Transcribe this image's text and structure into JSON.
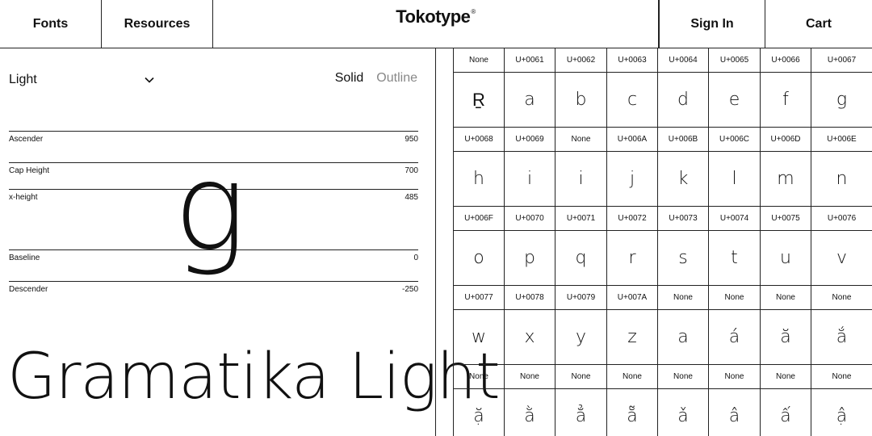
{
  "header": {
    "fonts_label": "Fonts",
    "resources_label": "Resources",
    "logo_text": "Tokotype",
    "logo_mark": "®",
    "signin_label": "Sign In",
    "cart_label": "Cart"
  },
  "weight": {
    "selected": "Light",
    "chevron_icon": "chevron-down-icon"
  },
  "style_toggle": {
    "solid_label": "Solid",
    "outline_label": "Outline"
  },
  "metrics": [
    {
      "label": "Ascender",
      "value": "950"
    },
    {
      "label": "Cap Height",
      "value": "700"
    },
    {
      "label": "x-height",
      "value": "485"
    },
    {
      "label": "Baseline",
      "value": "0"
    },
    {
      "label": "Descender",
      "value": "-250"
    }
  ],
  "preview_glyph": "g",
  "specimen_text": "Gramatika Light",
  "glyph_grid": [
    {
      "codes": [
        "None",
        "U+0061",
        "U+0062",
        "U+0063",
        "U+0064",
        "U+0065",
        "U+0066",
        "U+0067"
      ],
      "glyphs": [
        "R̠",
        "a",
        "b",
        "c",
        "d",
        "e",
        "f",
        "g"
      ]
    },
    {
      "codes": [
        "U+0068",
        "U+0069",
        "None",
        "U+006A",
        "U+006B",
        "U+006C",
        "U+006D",
        "U+006E"
      ],
      "glyphs": [
        "h",
        "i",
        "i",
        "j",
        "k",
        "l",
        "m",
        "n"
      ]
    },
    {
      "codes": [
        "U+006F",
        "U+0070",
        "U+0071",
        "U+0072",
        "U+0073",
        "U+0074",
        "U+0075",
        "U+0076"
      ],
      "glyphs": [
        "o",
        "p",
        "q",
        "r",
        "s",
        "t",
        "u",
        "v"
      ]
    },
    {
      "codes": [
        "U+0077",
        "U+0078",
        "U+0079",
        "U+007A",
        "None",
        "None",
        "None",
        "None"
      ],
      "glyphs": [
        "w",
        "x",
        "y",
        "z",
        "a",
        "á",
        "ă",
        "ắ"
      ]
    },
    {
      "codes": [
        "None",
        "None",
        "None",
        "None",
        "None",
        "None",
        "None",
        "None"
      ],
      "glyphs": [
        "ặ",
        "ằ",
        "ẳ",
        "ẵ",
        "ǎ",
        "â",
        "ấ",
        "ậ"
      ]
    }
  ]
}
